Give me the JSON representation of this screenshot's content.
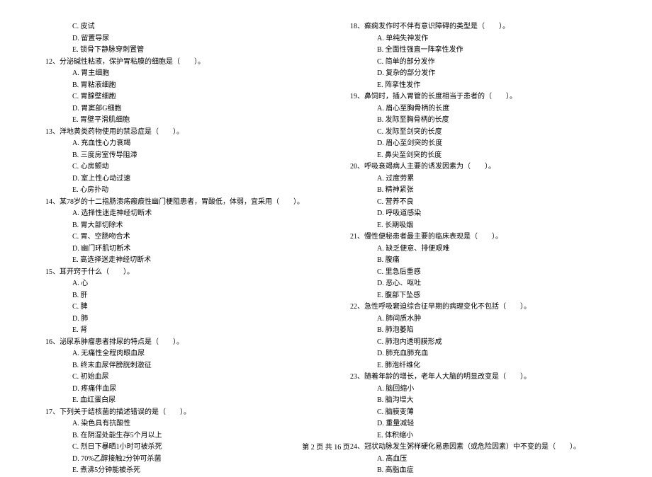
{
  "left": {
    "pre_opts": [
      "C. 皮试",
      "D. 留置导尿",
      "E. 锁骨下静脉穿刺置管"
    ],
    "q12": "12、分泌碱性粘液，保护胃粘膜的细胞是（　　）。",
    "q12_opts": [
      "A. 胃主细胞",
      "B. 胃粘液细胞",
      "C. 胃腺壁细胞",
      "D. 胃窦部G细胞",
      "E. 胃壁平滑肌细胞"
    ],
    "q13": "13、洋地黄类药物使用的禁忌症是（　　）。",
    "q13_opts": [
      "A. 充血性心力衰竭",
      "B. 三度房室传导阻滞",
      "C. 心房颤动",
      "D. 室上性心动过速",
      "E. 心房扑动"
    ],
    "q14": "14、某78岁的十二指肠溃疡瘢痕性幽门梗阻患者，胃酸低，体弱，宜采用（　　）。",
    "q14_opts": [
      "A. 选择性迷走神经切断术",
      "B. 胃大部切除术",
      "C. 胃、空肠吻合术",
      "D. 幽门环肌切断术",
      "E. 高选择迷走神经切断术"
    ],
    "q15": "15、耳开窍于什么（　　）。",
    "q15_opts": [
      "A. 心",
      "B. 肝",
      "C. 脾",
      "D. 肺",
      "E. 肾"
    ],
    "q16": "16、泌尿系肿瘤患者排尿的特点是（　　）。",
    "q16_opts": [
      "A. 无痛性全程肉眼血尿",
      "B. 终末血尿伴膀胱刺激征",
      "C. 初始血尿",
      "D. 疼痛伴血尿",
      "E. 血红蛋白尿"
    ],
    "q17": "17、下列关于结核菌的描述错误的是（　　）。",
    "q17_opts": [
      "A. 染色具有抗酸性",
      "B. 在阴湿处能生存5个月以上",
      "C. 烈日下暴晒1小时可被杀死",
      "D. 70%乙醇接触2分钟可杀菌",
      "E. 煮沸5分钟能被杀死"
    ]
  },
  "right": {
    "q18": "18、癫痫发作时不伴有意识障碍的类型是（　　）。",
    "q18_opts": [
      "A. 单纯失神发作",
      "B. 全面性强直一阵挛性发作",
      "C. 简单的部分发作",
      "D. 复杂的部分发作",
      "E. 阵挛性发作"
    ],
    "q19": "19、鼻饲时，插入胃管的长度相当于患者的（　　）。",
    "q19_opts": [
      "A. 眉心至胸骨柄的长度",
      "B. 发际至胸骨柄的长度",
      "C. 发际至剑突的长度",
      "D. 眉心至剑突的长度",
      "E. 鼻尖至剑突的长度"
    ],
    "q20": "20、呼吸衰竭病人主要的诱发因素为（　　）。",
    "q20_opts": [
      "A. 过度劳累",
      "B. 精神紧张",
      "C. 营养不良",
      "D. 呼吸道感染",
      "E. 长期吸烟"
    ],
    "q21": "21、慢性便秘患者最主要的临床表现是（　　）。",
    "q21_opts": [
      "A. 缺乏便意、排便艰难",
      "B. 腹痛",
      "C. 里急后重感",
      "D. 恶心、呕吐",
      "E. 腹部下坠感"
    ],
    "q22": "22、急性呼吸窘迫综合征早期的病理变化不包括（　　）。",
    "q22_opts": [
      "A. 肺间质水肿",
      "B. 肺泡萎陷",
      "C. 肺泡内透明膜形成",
      "D. 肺充血肺充血",
      "E. 肺泡纤维化"
    ],
    "q23": "23、随着年龄的增长，老年人大脑的明显改变是（　　）。",
    "q23_opts": [
      "A. 脑回缩小",
      "B. 脑沟增大",
      "C. 脑膜变薄",
      "D. 重量减轻",
      "E. 体积缩小"
    ],
    "q24": "24、冠状动脉发生粥样硬化易患因素（或危险因素）中不变的是（　　）。",
    "q24_opts": [
      "A. 高血压",
      "B. 高脂血症"
    ]
  },
  "footer": "第 2 页 共 16 页"
}
